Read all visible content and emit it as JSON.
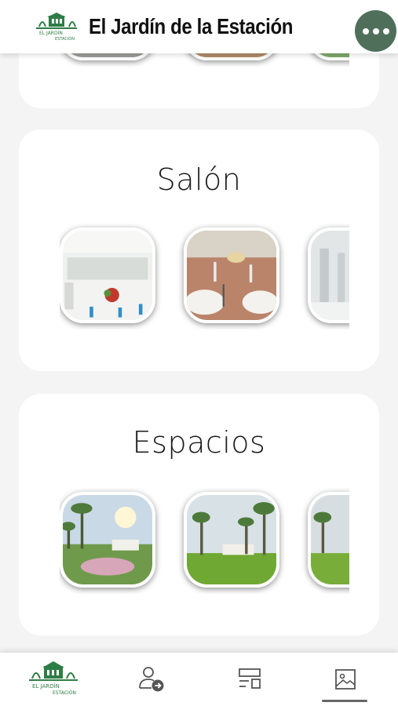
{
  "header": {
    "title": "El Jardín de la Estación",
    "logo_icon": "logo-icon",
    "more_icon": "more-dots-icon",
    "accent_color": "#4f6f5a"
  },
  "sections": [
    {
      "id": "top",
      "title": ""
    },
    {
      "id": "salon",
      "title": "Salón"
    },
    {
      "id": "espacios",
      "title": "Espacios"
    }
  ],
  "bottom_nav": {
    "items": [
      {
        "name": "home-logo",
        "icon": "logo-icon"
      },
      {
        "name": "account",
        "icon": "user-arrow-icon"
      },
      {
        "name": "menu",
        "icon": "layout-icon"
      },
      {
        "name": "gallery",
        "icon": "image-icon",
        "active": true
      }
    ]
  }
}
